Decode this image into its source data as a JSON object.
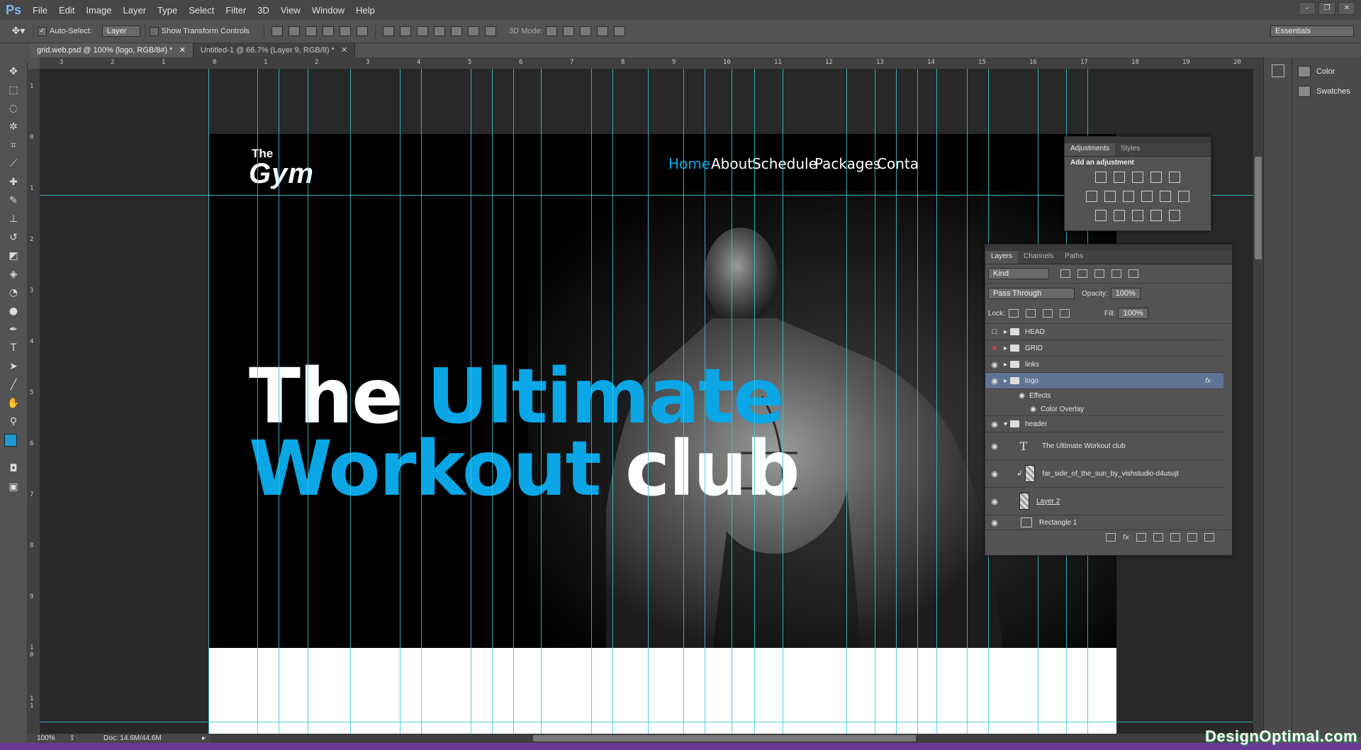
{
  "app": {
    "logo": "Ps"
  },
  "menu": [
    "File",
    "Edit",
    "Image",
    "Layer",
    "Type",
    "Select",
    "Filter",
    "3D",
    "View",
    "Window",
    "Help"
  ],
  "window_controls": [
    "–",
    "❐",
    "✕"
  ],
  "options": {
    "auto_select_label": "Auto-Select:",
    "auto_select_value": "Layer",
    "transform_label": "Show Transform Controls",
    "mode_label": "3D Mode:",
    "workspace": "Essentials"
  },
  "tabs": [
    {
      "label": "grid.web.psd @ 100% (logo, RGB/8#) *",
      "close": "✕"
    },
    {
      "label": "Untitled-1 @ 66.7% (Layer 9, RGB/8) *",
      "close": "✕"
    }
  ],
  "ruler_h_labels": [
    "3",
    "2",
    "1",
    "0",
    "1",
    "2",
    "3",
    "4",
    "5",
    "6",
    "7",
    "8",
    "9",
    "10",
    "11",
    "12",
    "13",
    "14",
    "15",
    "16",
    "17",
    "18",
    "19",
    "20"
  ],
  "ruler_v_labels": [
    "1",
    "0",
    "1",
    "2",
    "3",
    "4",
    "5",
    "6",
    "7",
    "8",
    "9",
    "1 0",
    "1 1"
  ],
  "canvas": {
    "logo_the": "The",
    "logo_gym": "Gym",
    "nav": [
      "Home",
      "About",
      "Schedule",
      "Packages",
      "Conta"
    ],
    "headline": {
      "w1": "The",
      "w2": "Ultimate",
      "w3": "Workout",
      "w4": "club"
    }
  },
  "status": {
    "zoom": "100%",
    "doc": "Doc: 14.6M/44.6M"
  },
  "dock": [
    {
      "icon": "color-icon",
      "label": "Color"
    },
    {
      "icon": "swatches-icon",
      "label": "Swatches"
    }
  ],
  "adjustments": {
    "tabs": [
      "Adjustments",
      "Styles"
    ],
    "title": "Add an adjustment"
  },
  "layers": {
    "tabs": [
      "Layers",
      "Channels",
      "Paths"
    ],
    "filter": "Kind",
    "blend": "Pass Through",
    "opacity_label": "Opacity:",
    "opacity": "100%",
    "lock_label": "Lock:",
    "fill_label": "Fill:",
    "fill": "100%",
    "fx": "fx",
    "rows": [
      {
        "name": "HEAD",
        "type": "folder"
      },
      {
        "name": "GRID",
        "type": "folder"
      },
      {
        "name": "links",
        "type": "folder"
      },
      {
        "name": "logo",
        "type": "folder"
      },
      {
        "name": "Effects",
        "type": "effect"
      },
      {
        "name": "Color Overlay",
        "type": "effect"
      },
      {
        "name": "header",
        "type": "folder"
      },
      {
        "name": "The Ultimate  Workout club",
        "type": "text"
      },
      {
        "name": "far_side_of_the_sun_by_vishstudio-d4usujt",
        "type": "image"
      },
      {
        "name": "Layer 2",
        "type": "image"
      },
      {
        "name": "Rectangle 1",
        "type": "shape"
      }
    ]
  },
  "colors": {
    "accent": "#0aa6e6",
    "guide": "#39c8d6",
    "selected_layer": "#5f7394"
  },
  "watermark": "DesignOptimal.com"
}
